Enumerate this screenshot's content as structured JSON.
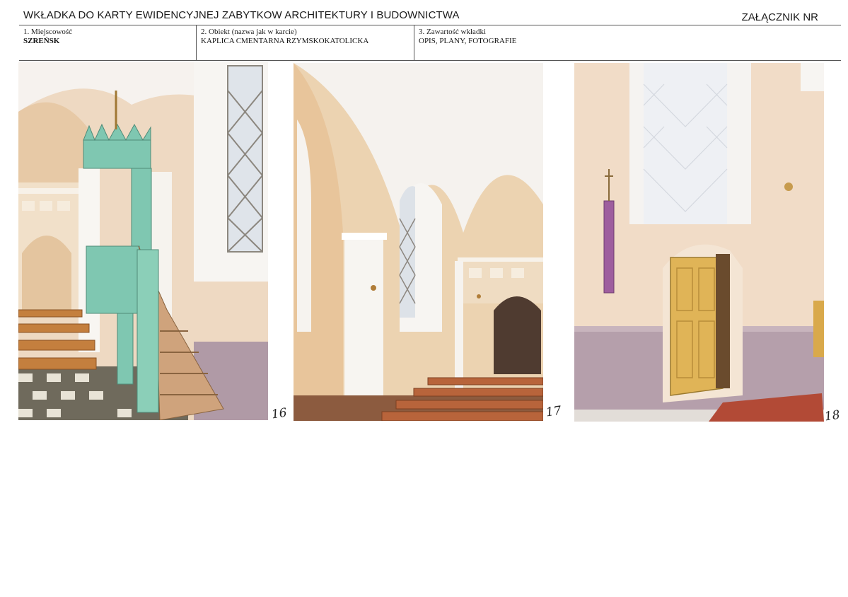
{
  "header": {
    "title": "WKŁADKA DO KARTY EWIDENCYJNEJ ZABYTKOW ARCHITEKTURY I BUDOWNICTWA",
    "annex_label": "ZAŁĄCZNIK NR"
  },
  "form": {
    "fields": [
      {
        "label": "1. Miejscowość",
        "value": "SZREŃSK"
      },
      {
        "label": "2. Obiekt (nazwa jak w karcie)",
        "value": "KAPLICA CMENTARNA RZYMSKOKATOLICKA"
      },
      {
        "label": "3. Zawartość wkładki",
        "value": "OPIS, PLANY, FOTOGRAFIE"
      }
    ]
  },
  "photos": [
    {
      "number": "16"
    },
    {
      "number": "17"
    },
    {
      "number": "18"
    }
  ]
}
